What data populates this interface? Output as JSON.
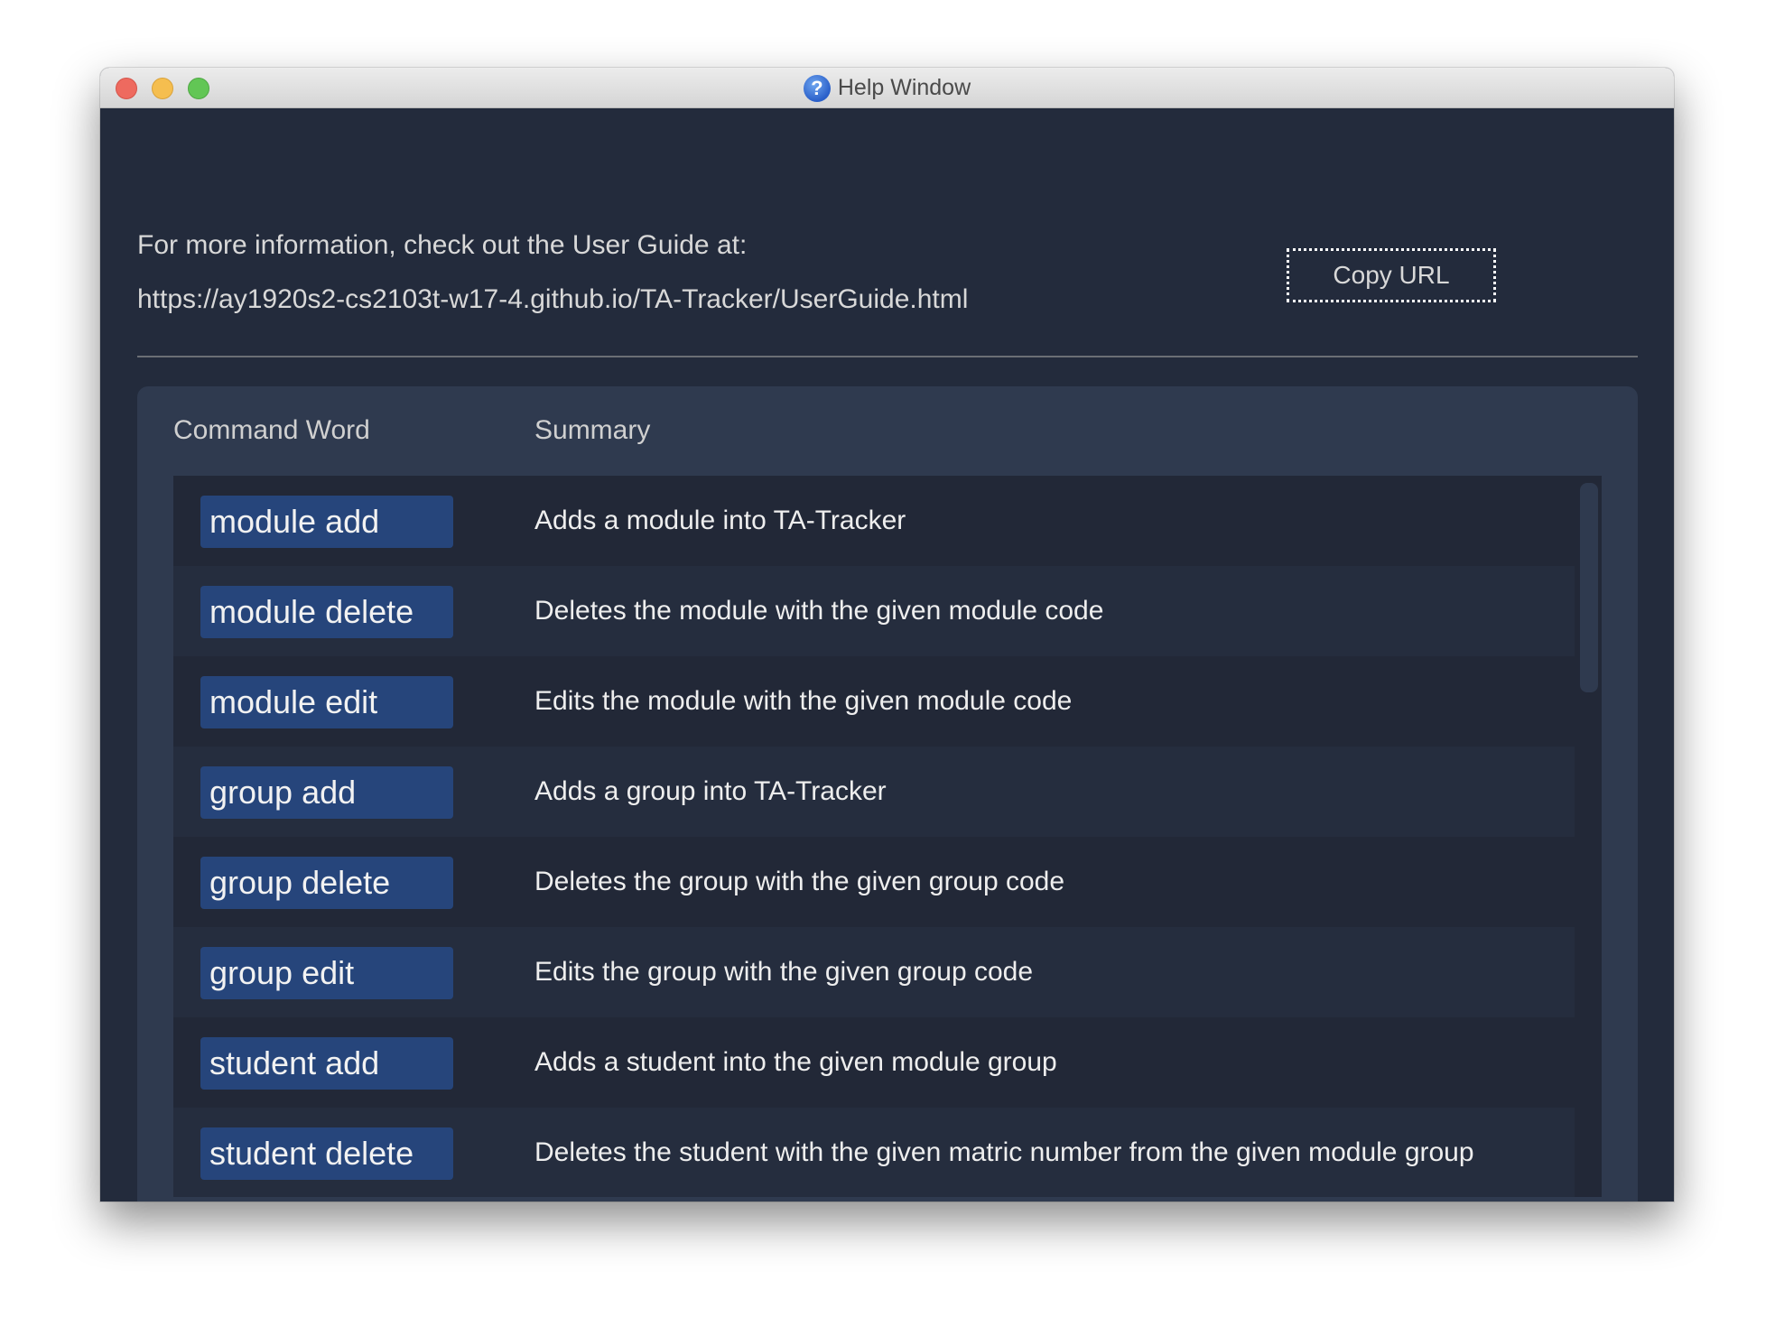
{
  "window": {
    "title": "Help Window",
    "title_icon": "help-question-icon"
  },
  "info": {
    "line1": "For more information, check out the User Guide at:",
    "url": "https://ay1920s2-cs2103t-w17-4.github.io/TA-Tracker/UserGuide.html",
    "copy_button_label": "Copy URL"
  },
  "table": {
    "headers": {
      "command": "Command Word",
      "summary": "Summary"
    },
    "rows": [
      {
        "command": "module add",
        "summary": "Adds a module into TA-Tracker"
      },
      {
        "command": "module delete",
        "summary": "Deletes the module with the given module code"
      },
      {
        "command": "module edit",
        "summary": "Edits the module with the given module code"
      },
      {
        "command": "group add",
        "summary": "Adds a group into TA-Tracker"
      },
      {
        "command": "group delete",
        "summary": "Deletes the group with the given group code"
      },
      {
        "command": "group edit",
        "summary": "Edits the group with the given group code"
      },
      {
        "command": "student add",
        "summary": "Adds a student into the given module group"
      },
      {
        "command": "student delete",
        "summary": "Deletes the student with the given matric number from the given module group"
      }
    ]
  },
  "colors": {
    "background": "#232b3c",
    "panel": "#2f3a4f",
    "list": "#222837",
    "badge": "#26457b",
    "text": "#eeeeee"
  }
}
